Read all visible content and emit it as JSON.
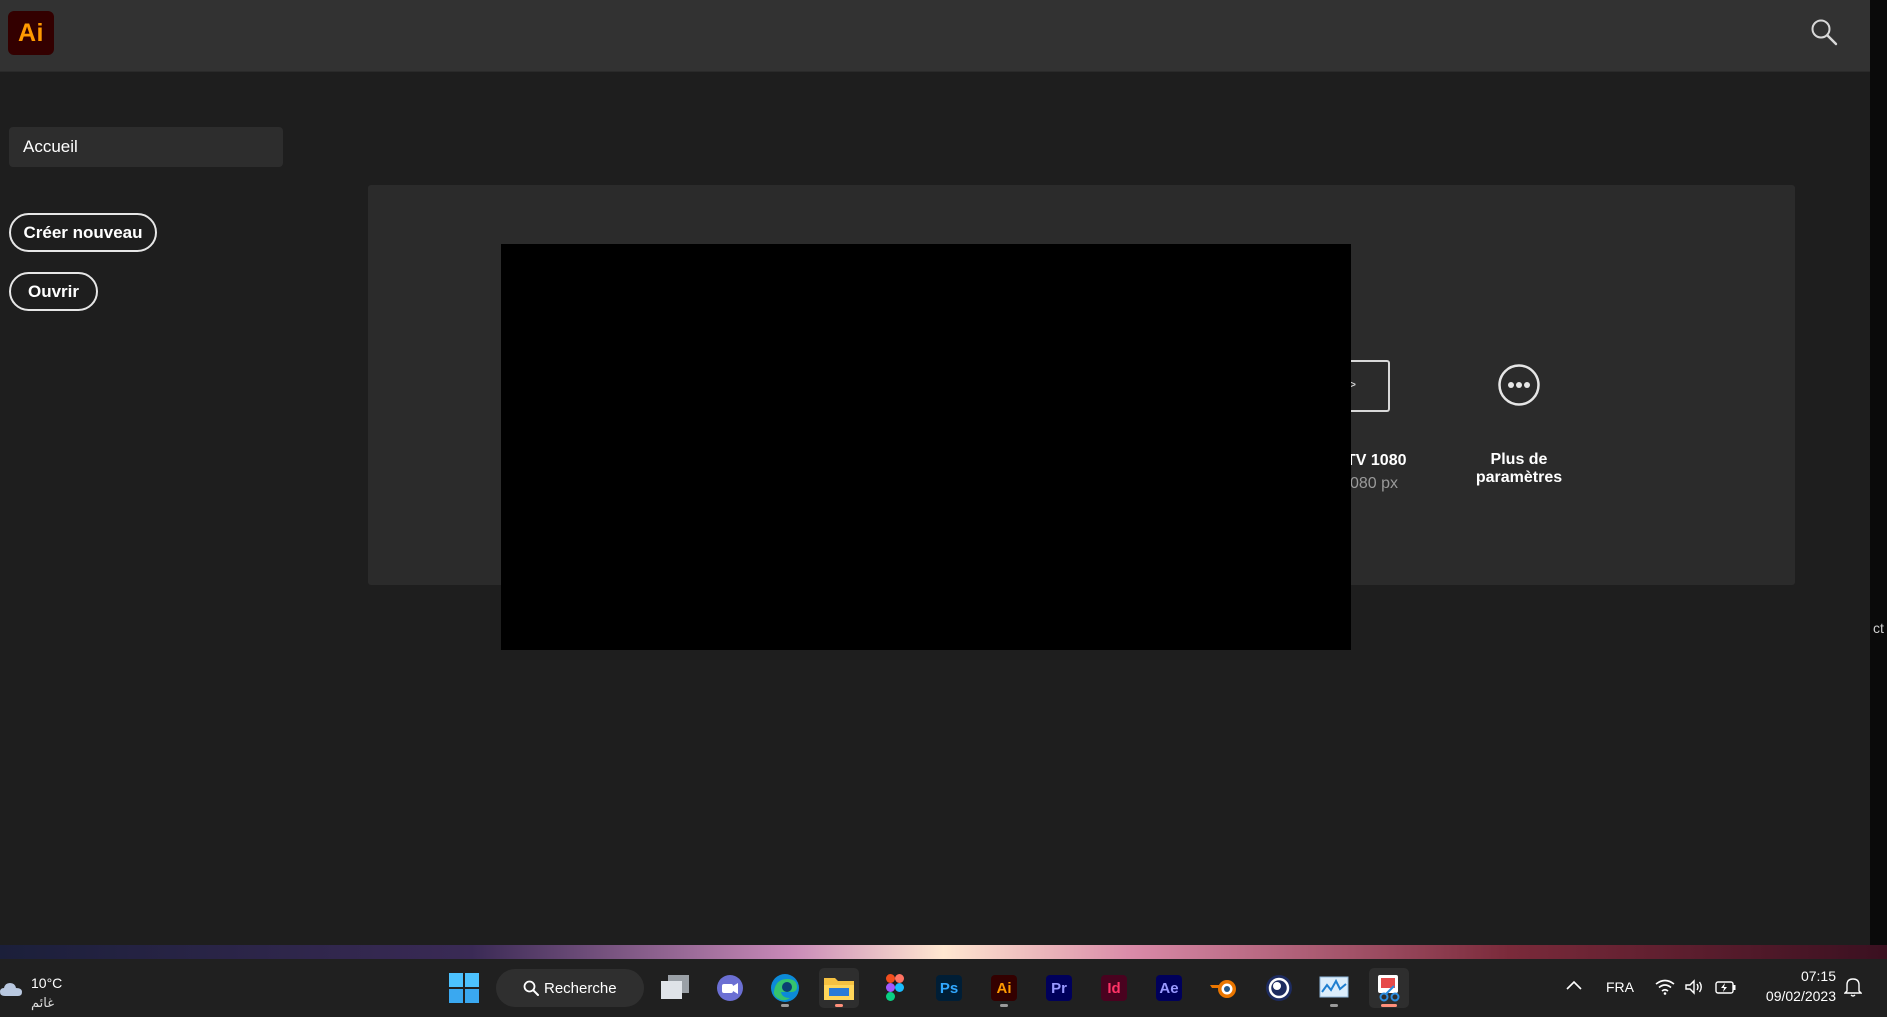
{
  "app": {
    "logo_text": "Ai"
  },
  "header": {
    "search_icon": "search-icon"
  },
  "sidebar": {
    "home_label": "Accueil",
    "create_new_label": "Créer nouveau",
    "open_label": "Ouvrir"
  },
  "presets": {
    "partial_title": "TV 1080",
    "partial_subtitle": "080 px",
    "more_label": "Plus de paramètres"
  },
  "right_edge_fragment": "ct",
  "taskbar": {
    "weather_temp": "10°C",
    "weather_desc": "غائم",
    "search_label": "Recherche",
    "apps": [
      {
        "name": "start",
        "icon": "windows-logo"
      },
      {
        "name": "task-view",
        "icon": "task-view-icon"
      },
      {
        "name": "teams",
        "icon": "video-chat-icon"
      },
      {
        "name": "edge",
        "icon": "edge-icon"
      },
      {
        "name": "file-explorer",
        "icon": "folder-icon"
      },
      {
        "name": "figma",
        "icon": "figma-icon"
      },
      {
        "name": "photoshop",
        "label": "Ps",
        "color": "#31a8ff",
        "bg": "#001e36"
      },
      {
        "name": "illustrator",
        "label": "Ai",
        "color": "#ff9a00",
        "bg": "#330000"
      },
      {
        "name": "premiere",
        "label": "Pr",
        "color": "#9999ff",
        "bg": "#00005b"
      },
      {
        "name": "indesign",
        "label": "Id",
        "color": "#ff3366",
        "bg": "#49021f"
      },
      {
        "name": "after-effects",
        "label": "Ae",
        "color": "#9999ff",
        "bg": "#00005b"
      },
      {
        "name": "blender",
        "icon": "blender-icon"
      },
      {
        "name": "cinema4d",
        "icon": "cinema4d-icon"
      },
      {
        "name": "resource-monitor",
        "icon": "monitor-chart-icon"
      },
      {
        "name": "snipping-tool",
        "icon": "snipping-tool-icon"
      }
    ],
    "tray": {
      "language": "FRA",
      "time": "07:15",
      "date": "09/02/2023"
    }
  },
  "colors": {
    "accent_ai": "#ff9a00",
    "bg": "#1e1e1e",
    "panel": "#2b2b2b"
  }
}
